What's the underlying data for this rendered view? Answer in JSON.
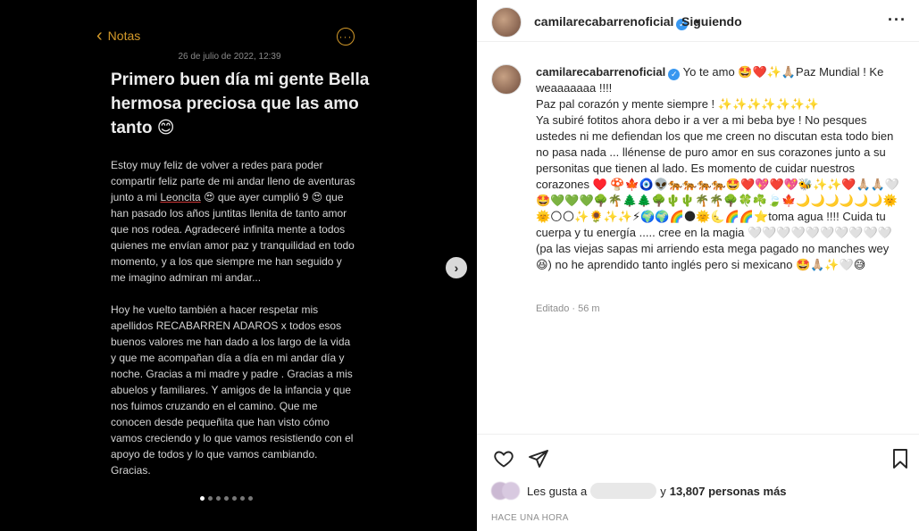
{
  "note": {
    "back_label": "Notas",
    "more_icon": "···",
    "date": "26 de julio de 2022, 12:39",
    "title": "Primero buen día mi gente Bella hermosa preciosa que las amo tanto 😊",
    "body_p1_a": "Estoy muy feliz de volver a redes para poder compartir feliz parte de mi andar lleno de aventuras junto a mi ",
    "body_p1_link": "Leoncita",
    "body_p1_b": " 😍 que ayer cumplió 9 😍 que han pasado los años juntitas llenita de tanto amor que nos rodea. Agradeceré infinita mente a todos quienes me envían amor paz y tranquilidad en todo momento, y a los que siempre me han seguido y me imagino admiran mi andar...",
    "body_p2": "Hoy he vuelto también a hacer respetar mis apellidos RECABARREN ADAROS x todos esos buenos valores me han dado a los largo de la vida y que me acompañan día a día en mi andar día y noche. Gracias a mi madre y padre . Gracias a mis abuelos y familiares. Y amigos de la infancia y que nos fuimos cruzando en el camino. Que me conocen desde pequeñita que han visto cómo vamos creciendo y lo que vamos resistiendo con el apoyo de todos y lo que vamos cambiando. Gracias.",
    "carousel_dots": 7,
    "carousel_active": 0,
    "next_icon": "›"
  },
  "header": {
    "username": "camilarecabarrenoficial",
    "separator": "•",
    "follow_state": "Siguiendo",
    "more_icon": "···"
  },
  "caption": {
    "username": "camilarecabarrenoficial",
    "text": "Yo te amo 🤩❤️✨🙏🏼Paz Mundial ! Ke weaaaaaaa !!!!\nPaz pal corazón y mente siempre ! ✨✨✨✨✨✨✨\nYa subiré fotitos ahora debo ir a ver a mi beba bye ! No pesques ustedes ni me defiendan los que me creen no discutan esta todo bien no pasa nada ... llénense de puro amor en sus corazones junto a su personitas que tienen al lado. Es momento de cuidar nuestros corazones ♥️ 🍄🍁🧿👽🐅🐅🐅🐅🤩❤️💖❤️💖🐝✨✨❤️🙏🏼🙏🏼🤍🤩💚💚💚🌳🌴🌲🌲🌳🌵🌵🌴🌴🌳🍀☘️🍃🍁🌙🌙🌙🌙🌙🌙🌞🌞🌕🌕✨🌻✨✨⚡🌍🌍🌈🌑🌞🌜🌈🌈⭐toma agua !!!! Cuida tu cuerpa y tu energía ..... cree en la magia 🤍🤍🤍🤍🤍🤍🤍🤍🤍🤍(pa las viejas sapas mi arriendo esta mega pagado no manches wey 😆) no he aprendido tanto inglés pero si mexicano 🤩🙏🏼✨🤍😅",
    "edited": "Editado · 56 m"
  },
  "likes": {
    "prefix": "Les gusta a",
    "connector": "y",
    "count_text": "13,807 personas más"
  },
  "time_label": "HACE UNA HORA",
  "icons": [
    "heart-icon",
    "share-icon",
    "bookmark-icon",
    "verified-badge-icon",
    "chevron-left-icon",
    "more-icon",
    "next-arrow-icon"
  ]
}
